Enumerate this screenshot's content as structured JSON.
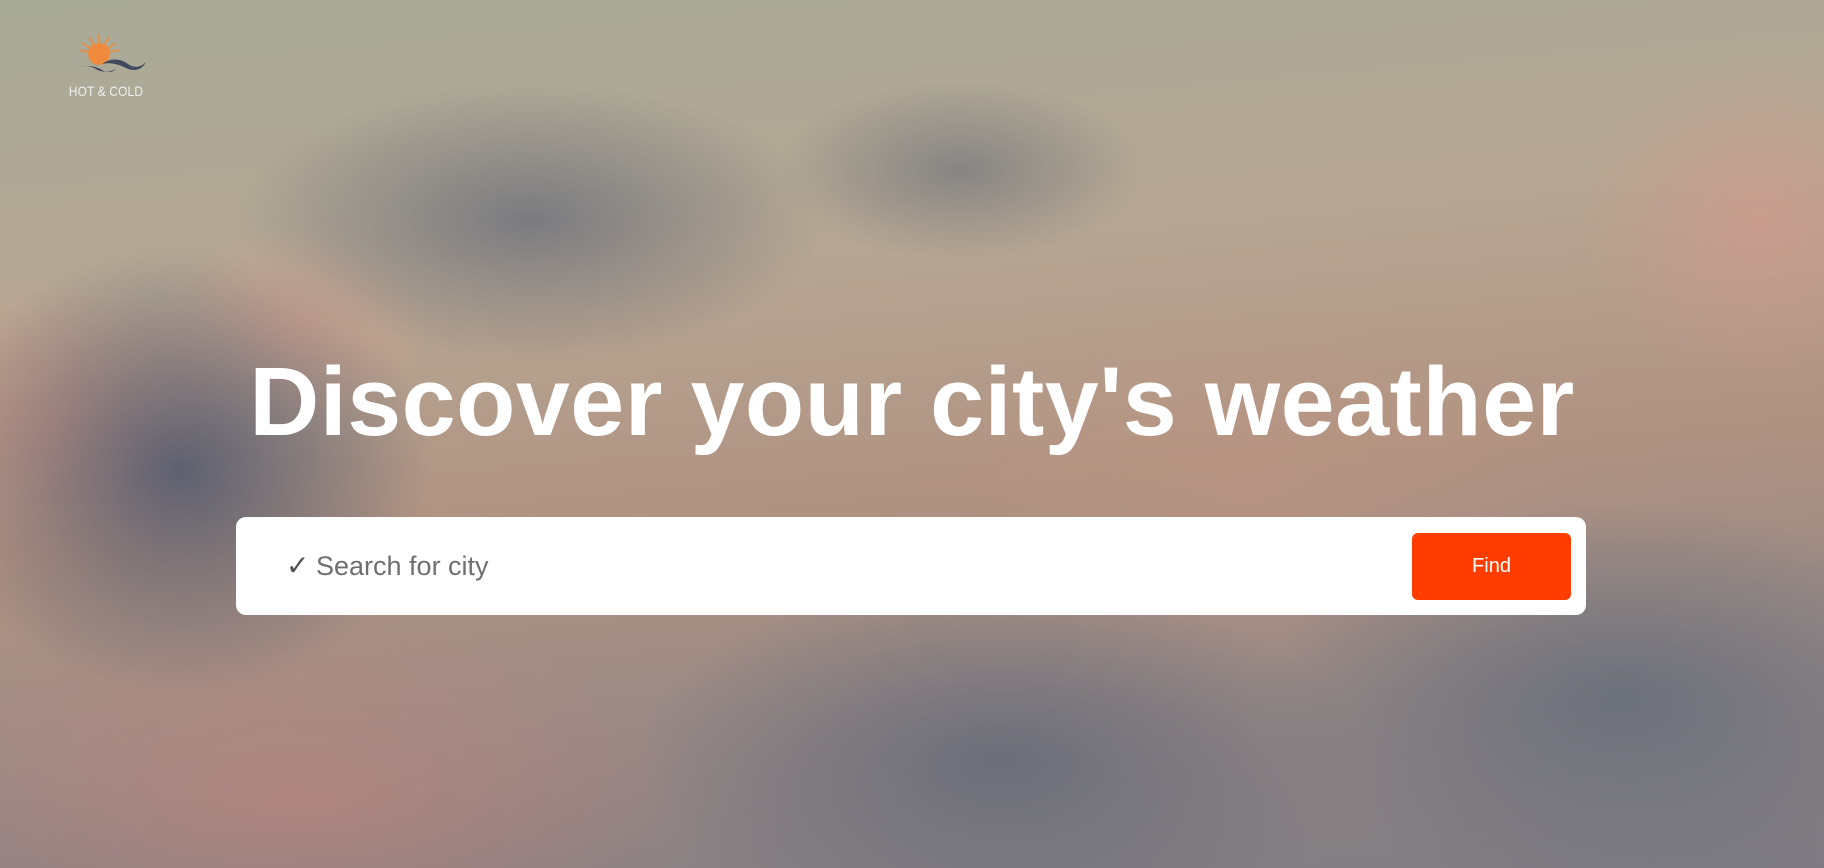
{
  "brand": {
    "name": "HOT & COLD",
    "logo_icon": "sun-waves-icon"
  },
  "hero": {
    "title": "Discover your city's weather"
  },
  "search": {
    "icon": "checkmark-icon",
    "icon_glyph": "✓",
    "placeholder": "Search for city",
    "value": "",
    "button_label": "Find"
  },
  "colors": {
    "accent": "#ff3d00",
    "sun": "#f08a3c",
    "wave": "#3f4a5e",
    "title_text": "#ffffff"
  }
}
